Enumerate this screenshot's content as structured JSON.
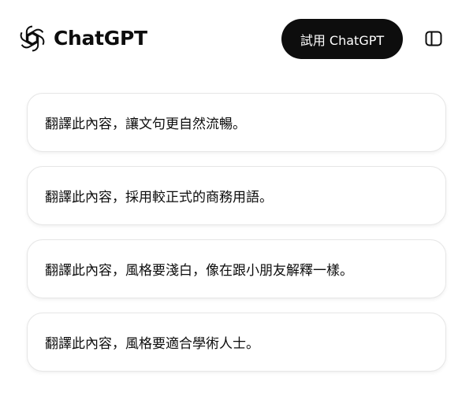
{
  "header": {
    "brand_name": "ChatGPT",
    "logo_icon": "openai-logo-icon",
    "try_button_label": "試用 ChatGPT",
    "sidebar_toggle_icon": "sidebar-toggle-icon"
  },
  "suggestions": [
    {
      "label": "翻譯此內容，讓文句更自然流暢。"
    },
    {
      "label": "翻譯此內容，採用較正式的商務用語。"
    },
    {
      "label": "翻譯此內容，風格要淺白，像在跟小朋友解釋一樣。"
    },
    {
      "label": "翻譯此內容，風格要適合學術人士。"
    }
  ],
  "colors": {
    "button_bg": "#0d0d0d",
    "button_text": "#ffffff",
    "card_border": "#e6e6e6",
    "text": "#0d0d0d"
  }
}
